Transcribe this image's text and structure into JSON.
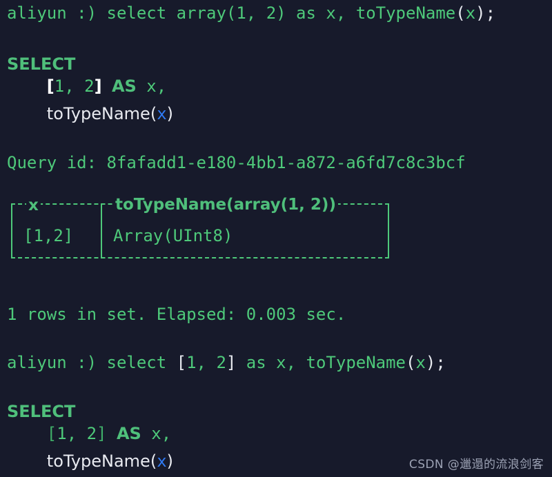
{
  "terminal": {
    "background_color": "#171a2b",
    "green": "#4ec97a",
    "bold_green": "#4fbf7b",
    "white": "#e8eaf0",
    "blue": "#2f7bf6"
  },
  "prompt1": {
    "prefix": "aliyun :) ",
    "command": "select array(1, 2) as x, toTypeName(x);",
    "full": "aliyun :) select array(1, 2) as x, toTypeName(x);",
    "cmd_head": "select array",
    "cmd_open": "(",
    "cmd_args": "1, 2",
    "cmd_close": ")",
    "cmd_as": " as x, ",
    "fn_name": "toTypeName",
    "fn_open": "(",
    "fn_arg": "x",
    "fn_close": ")",
    "semicolon": ";"
  },
  "echo1": {
    "keyword": "SELECT",
    "line2_indent": "    ",
    "line2_open_bracket": "[",
    "line2_values": "1, 2",
    "line2_close_bracket": "]",
    "line2_as": "AS",
    "line2_alias": "x,",
    "line3_indent": "    ",
    "line3_fn": "toTypeName",
    "line3_open": "(",
    "line3_arg": "x",
    "line3_close": ")"
  },
  "query_id": {
    "label": "Query id: ",
    "value": "8fafadd1-e180-4bb1-a872-a6fd7c8c3bcf",
    "full": "Query id: 8fafadd1-e180-4bb1-a872-a6fd7c8c3bcf"
  },
  "result_table": {
    "headers": [
      "x",
      "toTypeName(array(1, 2))"
    ],
    "rows": [
      [
        "[1,2]",
        "Array(UInt8)"
      ]
    ]
  },
  "stats": {
    "full": "1 rows in set. Elapsed: 0.003 sec.",
    "rows": "1",
    "elapsed": "0.003"
  },
  "prompt2": {
    "prefix": "aliyun :) ",
    "command": "select [1, 2] as x, toTypeName(x);",
    "full": "aliyun :) select [1, 2] as x, toTypeName(x);",
    "cmd_head": "select ",
    "br_open": "[",
    "cmd_args": "1, 2",
    "br_close": "]",
    "cmd_as": " as x, ",
    "fn_name": "toTypeName",
    "fn_open": "(",
    "fn_arg": "x",
    "fn_close": ")",
    "semicolon": ";"
  },
  "echo2": {
    "keyword": "SELECT",
    "line2_indent": "    ",
    "line2_open_bracket": "[",
    "line2_values": "1, 2",
    "line2_close_bracket": "]",
    "line2_as": "AS",
    "line2_alias": "x,",
    "line3_indent": "    ",
    "line3_fn": "toTypeName",
    "line3_open": "(",
    "line3_arg": "x",
    "line3_close": ")"
  },
  "watermark": {
    "text": "CSDN @邋遢的流浪剑客"
  }
}
